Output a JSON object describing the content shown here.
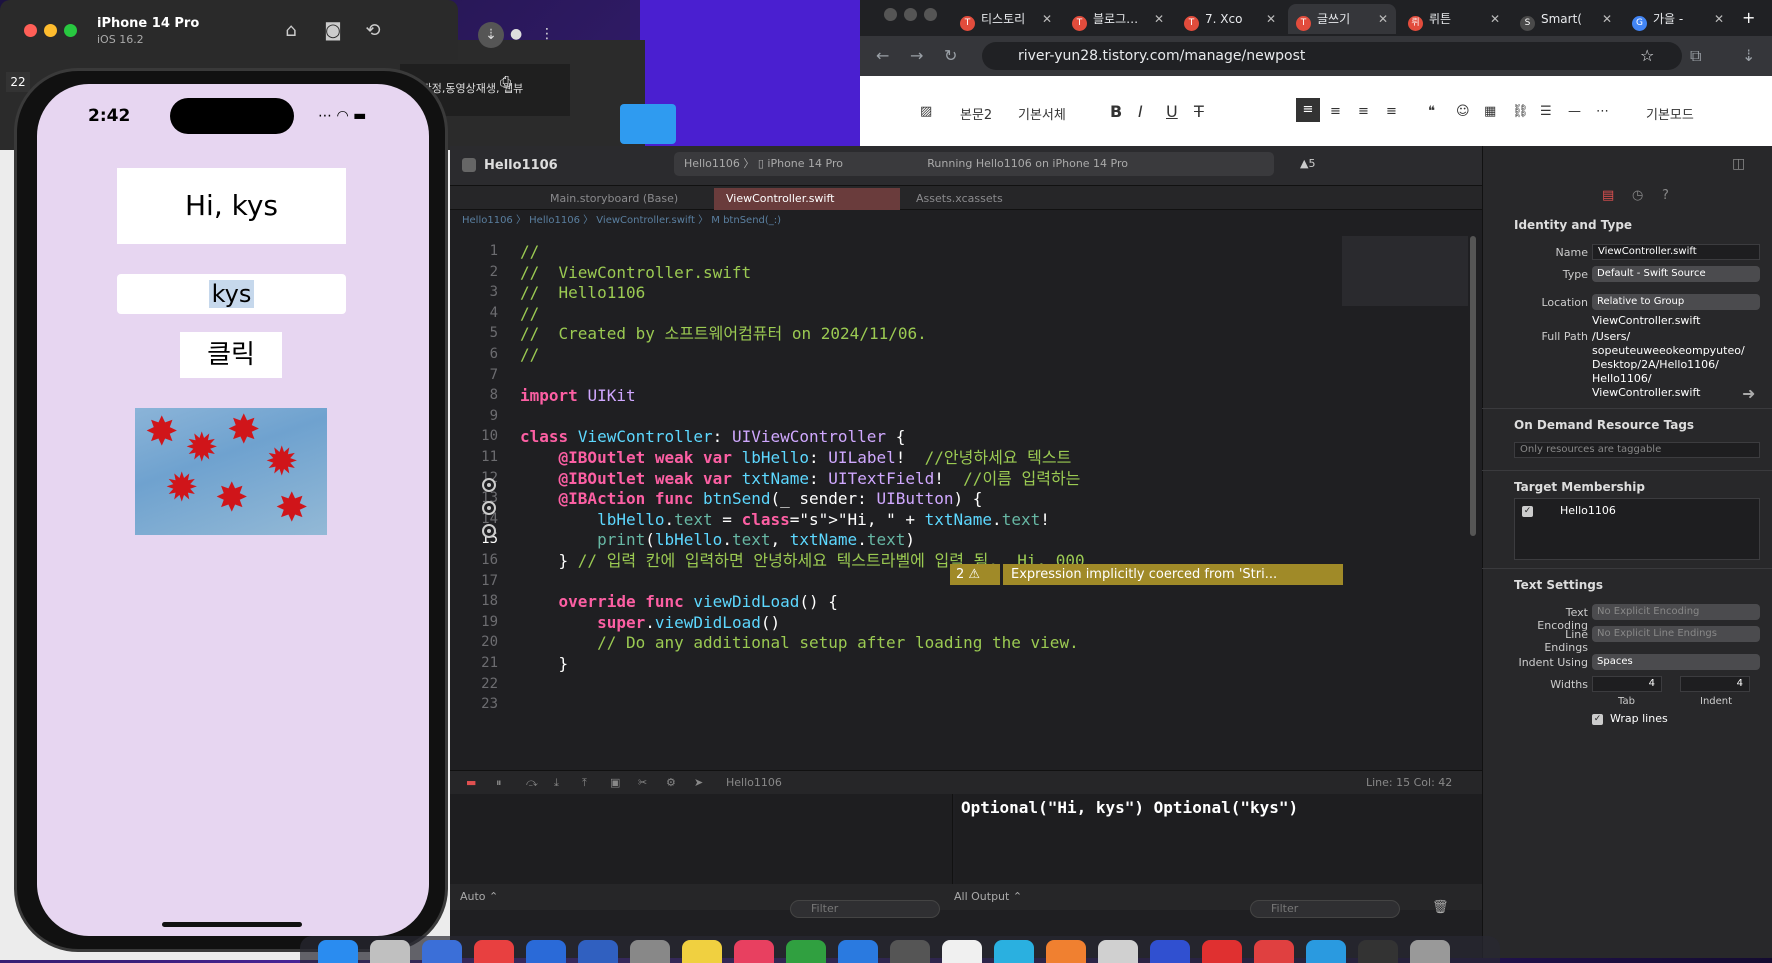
{
  "simulator": {
    "device_name": "iPhone 14 Pro",
    "os_version": "iOS 16.2",
    "time": "2:42",
    "status_icons": "⋯ ◠ ▬",
    "side_badge": "22"
  },
  "app": {
    "hello_label": "Hi, kys",
    "name_field_value": "kys",
    "send_button": "클릭",
    "image_name": "autumn-maple-leaves-image"
  },
  "behind_window": {
    "snippet": "시 판정,동영상재생, 웹뷰"
  },
  "browser": {
    "tabs": [
      {
        "icon": "T",
        "label": "티스토리"
      },
      {
        "icon": "T",
        "label": "블로그…"
      },
      {
        "icon": "T",
        "label": "7. Xco"
      },
      {
        "icon": "T",
        "label": "글쓰기"
      },
      {
        "icon": "뤼",
        "label": "뤼튼"
      },
      {
        "icon": "S",
        "label": "Smart("
      },
      {
        "icon": "G",
        "label": "가을 - "
      }
    ],
    "url": "river-yun28.tistory.com/manage/newpost",
    "editor_toolbar": {
      "paragraph": "본문2",
      "font": "기본서체",
      "mode": "기본모드"
    }
  },
  "xcode": {
    "project": "Hello1106",
    "scheme_text": "Hello1106 〉 ▯ iPhone 14 Pro",
    "run_status": "Running Hello1106 on iPhone 14 Pro",
    "warning_count": "▲5",
    "tabs": [
      "Main.storyboard (Base)",
      "ViewController.swift",
      "Assets.xcassets"
    ],
    "jumpbar": "Hello1106 〉 Hello1106 〉 ViewController.swift 〉 M btnSend(_:)",
    "code_lines": [
      {
        "n": "1",
        "text": "//"
      },
      {
        "n": "2",
        "text": "//  ViewController.swift"
      },
      {
        "n": "3",
        "text": "//  Hello1106"
      },
      {
        "n": "4",
        "text": "//"
      },
      {
        "n": "5",
        "text": "//  Created by 소프트웨어컴퓨터 on 2024/11/06."
      },
      {
        "n": "6",
        "text": "//"
      },
      {
        "n": "7",
        "text": ""
      },
      {
        "n": "8",
        "text": "import UIKit"
      },
      {
        "n": "9",
        "text": ""
      },
      {
        "n": "10",
        "text": "class ViewController: UIViewController {"
      },
      {
        "n": "11",
        "text": "    @IBOutlet weak var lbHello: UILabel!  //안녕하세요 텍스트"
      },
      {
        "n": "12",
        "text": "    @IBOutlet weak var txtName: UITextField!  //이름 입력하는"
      },
      {
        "n": "13",
        "text": "    @IBAction func btnSend(_ sender: UIButton) {"
      },
      {
        "n": "14",
        "text": "        lbHello.text = \"Hi, \" + txtName.text!"
      },
      {
        "n": "15",
        "text": "        print(lbHello.text, txtName.text)"
      },
      {
        "n": "16",
        "text": "    } // 입력 칸에 입력하면 안녕하세요 텍스트라벨에 입력 됨.  Hi, 000"
      },
      {
        "n": "17",
        "text": ""
      },
      {
        "n": "18",
        "text": "    override func viewDidLoad() {"
      },
      {
        "n": "19",
        "text": "        super.viewDidLoad()"
      },
      {
        "n": "20",
        "text": "        // Do any additional setup after loading the view."
      },
      {
        "n": "21",
        "text": "    }"
      },
      {
        "n": "22",
        "text": ""
      },
      {
        "n": "23",
        "text": ""
      }
    ],
    "warning_badge": "2 ⚠",
    "warning_message": "Expression implicitly coerced from 'Stri...",
    "debug_target": "Hello1106",
    "cursor_pos": "Line: 15  Col: 42",
    "console_output": "Optional(\"Hi, kys\") Optional(\"kys\")",
    "vars_scope": "Auto ⌃",
    "output_scope": "All Output ⌃",
    "filter_placeholder": "Filter"
  },
  "inspector": {
    "identity_title": "Identity and Type",
    "name_label": "Name",
    "name_value": "ViewController.swift",
    "type_label": "Type",
    "type_value": "Default - Swift Source",
    "location_label": "Location",
    "location_value": "Relative to Group",
    "location_file": "ViewController.swift",
    "fullpath_label": "Full Path",
    "fullpath_value": "/Users/\nsopeuteuweeokeompyuteo/\nDesktop/2A/Hello1106/\nHello1106/\nViewController.swift",
    "odr_title": "On Demand Resource Tags",
    "odr_placeholder": "Only resources are taggable",
    "target_title": "Target Membership",
    "target_item": "Hello1106",
    "text_title": "Text Settings",
    "encoding_label": "Text Encoding",
    "encoding_value": "No Explicit Encoding",
    "endings_label": "Line Endings",
    "endings_value": "No Explicit Line Endings",
    "indent_label": "Indent Using",
    "indent_value": "Spaces",
    "widths_label": "Widths",
    "tab_value": "4",
    "indent_width_value": "4",
    "tab_label": "Tab",
    "indent_label2": "Indent",
    "wrap_label": "Wrap lines"
  },
  "colors": {
    "phone_bg": "#e7d6f1",
    "xcode_bg": "#1f1f22",
    "warning": "#a08a28",
    "keyword": "#fc5fa3",
    "comment": "#9bca52"
  }
}
